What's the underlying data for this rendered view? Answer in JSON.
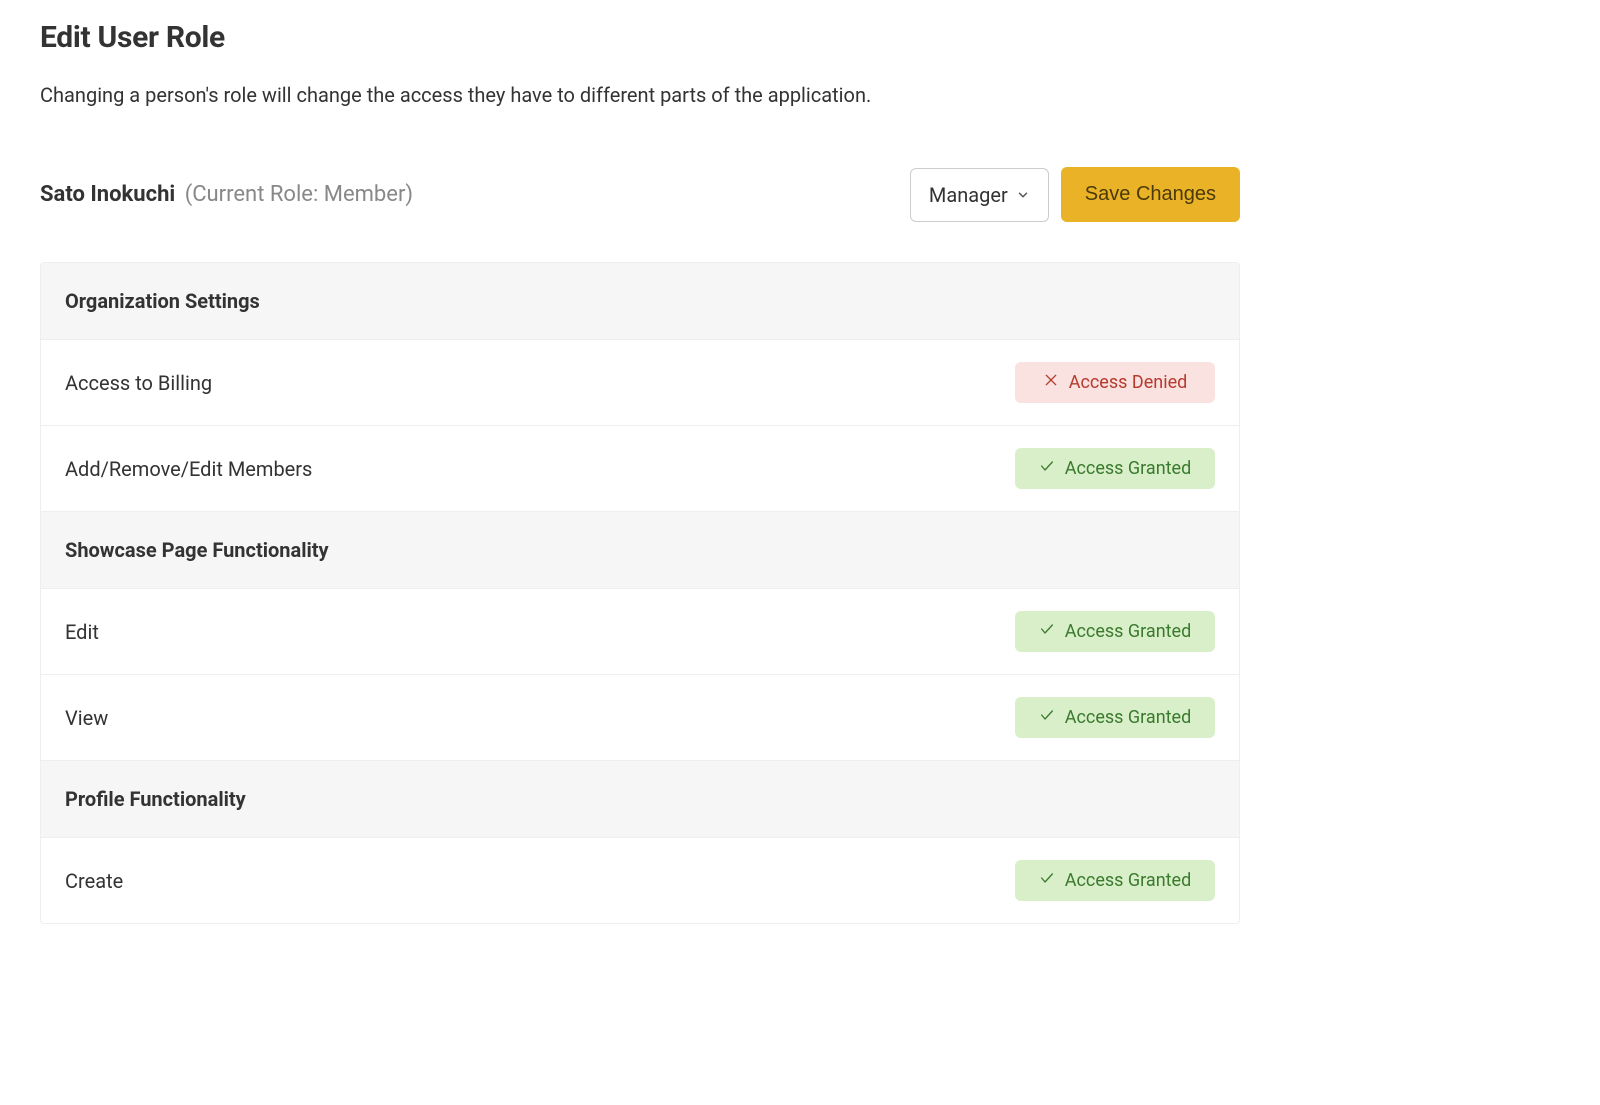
{
  "page": {
    "title": "Edit User Role",
    "description": "Changing a person's role will change the access they have to different parts of the application."
  },
  "user": {
    "name": "Sato Inokuchi",
    "current_role_label": "(Current Role: Member)"
  },
  "controls": {
    "role_selected": "Manager",
    "save_label": "Save Changes"
  },
  "badges": {
    "denied": "Access Denied",
    "granted": "Access Granted"
  },
  "sections": [
    {
      "title": "Organization Settings",
      "permissions": [
        {
          "label": "Access to Billing",
          "status": "denied"
        },
        {
          "label": "Add/Remove/Edit Members",
          "status": "granted"
        }
      ]
    },
    {
      "title": "Showcase Page Functionality",
      "permissions": [
        {
          "label": "Edit",
          "status": "granted"
        },
        {
          "label": "View",
          "status": "granted"
        }
      ]
    },
    {
      "title": "Profile Functionality",
      "permissions": [
        {
          "label": "Create",
          "status": "granted"
        }
      ]
    }
  ]
}
